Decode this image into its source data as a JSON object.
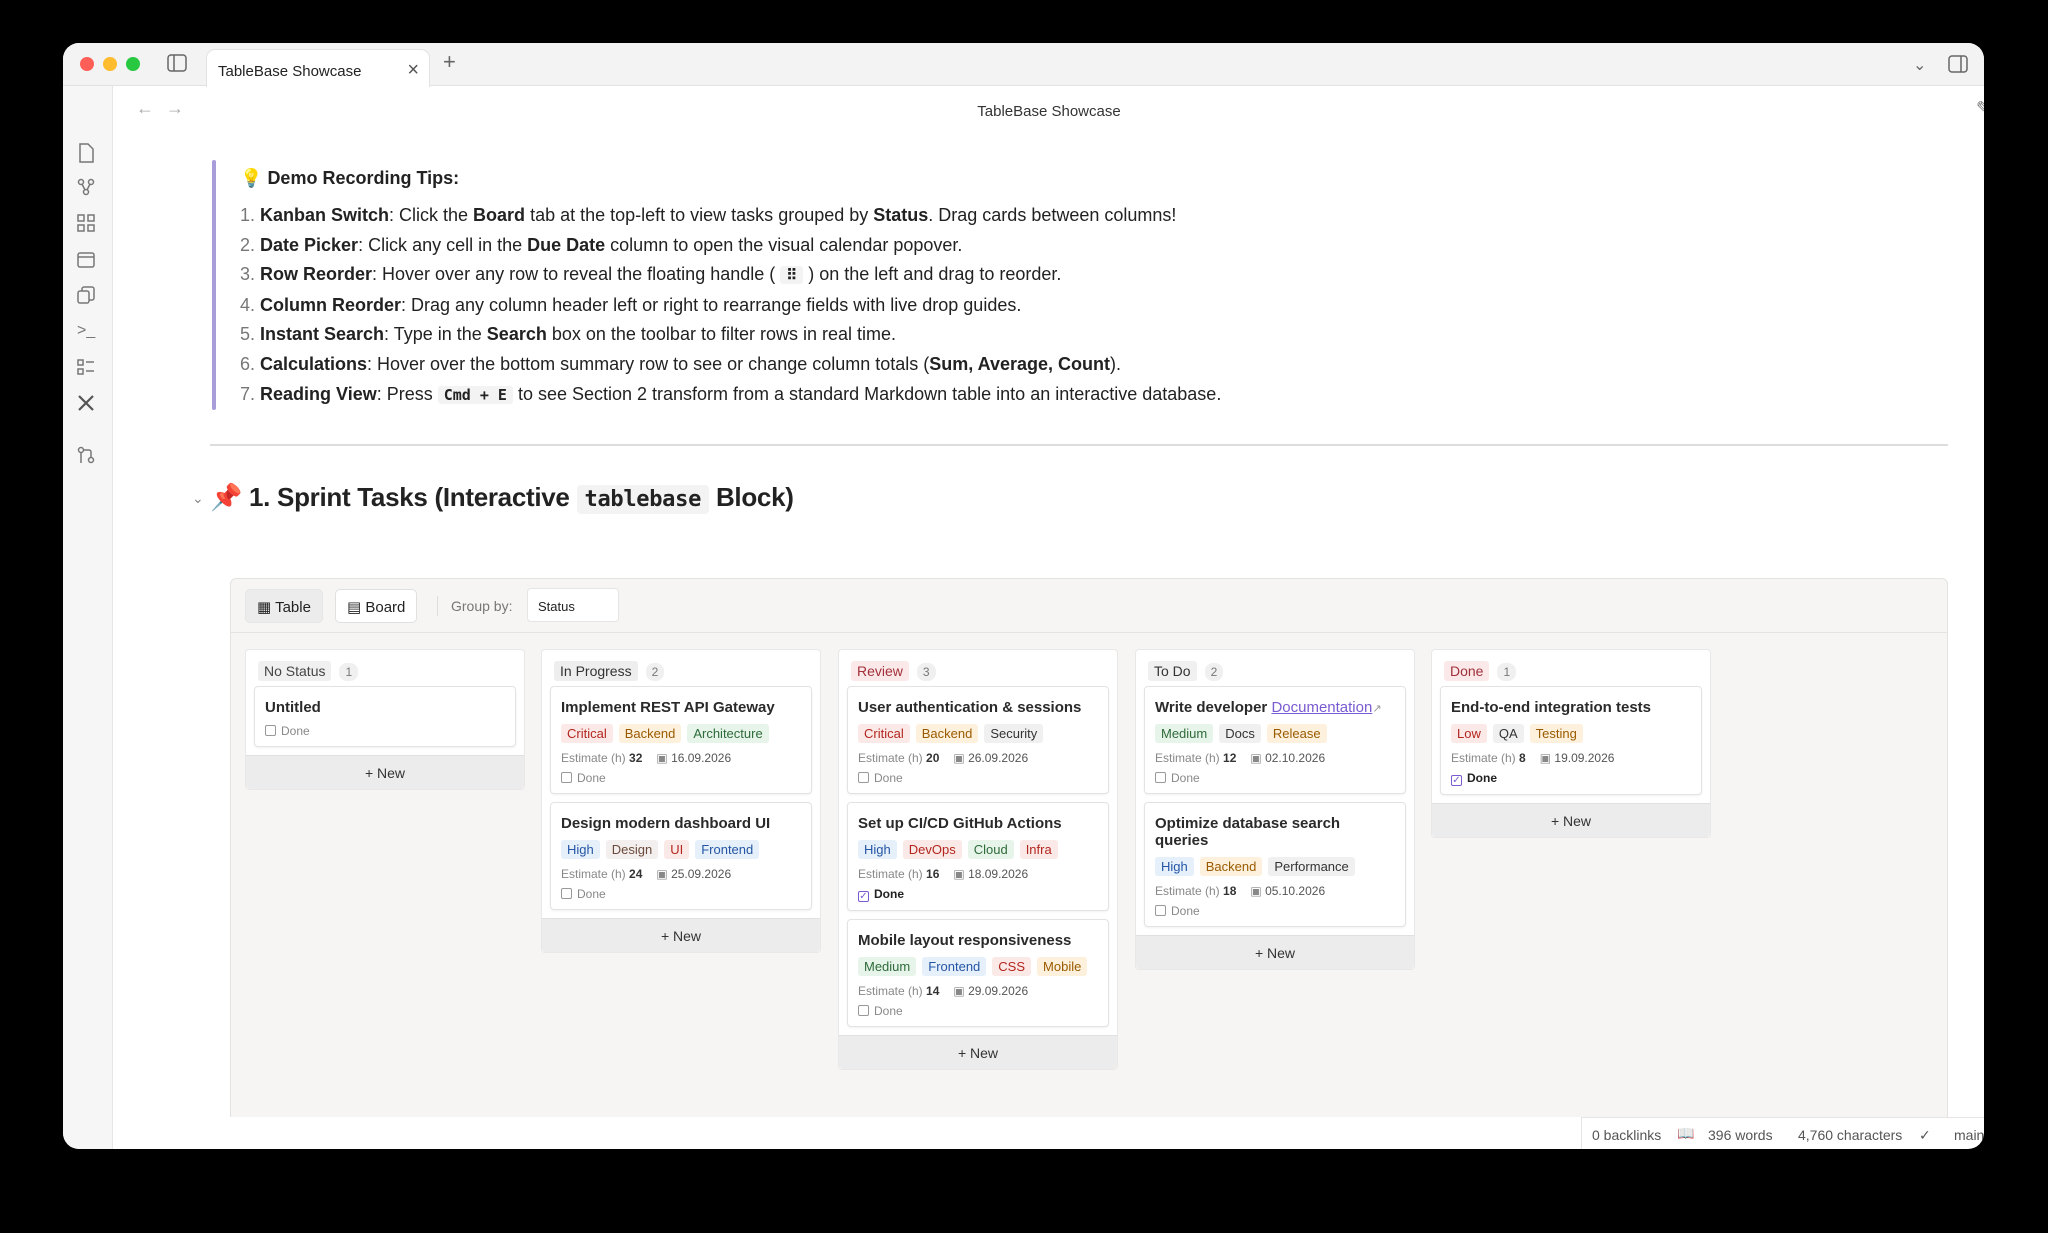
{
  "window": {
    "tab_title": "TableBase Showcase",
    "page_title": "TableBase Showcase"
  },
  "tips": {
    "title": "Demo Recording Tips:",
    "items": [
      {
        "n": "1.",
        "head": "Kanban Switch",
        "parts": [
          ": Click the ",
          "Board",
          " tab at the top-left to view tasks grouped by ",
          "Status",
          ". Drag cards between columns!"
        ]
      },
      {
        "n": "2.",
        "head": "Date Picker",
        "parts": [
          ": Click any cell in the ",
          "Due Date",
          " column to open the visual calendar popover."
        ]
      },
      {
        "n": "3.",
        "head": "Row Reorder",
        "parts": [
          ": Hover over any row to reveal the floating handle ( ",
          "⠿",
          " ) on the left and drag to reorder."
        ]
      },
      {
        "n": "4.",
        "head": "Column Reorder",
        "parts": [
          ": Drag any column header left or right to rearrange fields with live drop guides."
        ]
      },
      {
        "n": "5.",
        "head": "Instant Search",
        "parts": [
          ": Type in the ",
          "Search",
          " box on the toolbar to filter rows in real time."
        ]
      },
      {
        "n": "6.",
        "head": "Calculations",
        "parts": [
          ": Hover over the bottom summary row to see or change column totals (",
          "Sum, Average, Count",
          ")."
        ]
      },
      {
        "n": "7.",
        "head": "Reading View",
        "parts": [
          ": Press ",
          "Cmd + E",
          " to see Section 2 transform from a standard Markdown table into an interactive database."
        ]
      }
    ]
  },
  "section": {
    "prefix": "1. Sprint Tasks (Interactive ",
    "code": "tablebase",
    "suffix": " Block)"
  },
  "toolbar": {
    "table_label": "Table",
    "board_label": "Board",
    "groupby_label": "Group by:",
    "groupby_value": "Status"
  },
  "new_label": "New",
  "estimate_label": "Estimate (h)",
  "done_label": "Done",
  "columns": [
    {
      "name": "No Status",
      "count": "1",
      "color": "#f0f0f0",
      "text": "#444",
      "cards": [
        {
          "title": "Untitled",
          "tags": [],
          "estimate": "",
          "date": "",
          "done": false
        }
      ]
    },
    {
      "name": "In Progress",
      "count": "2",
      "color": "#eeeeee",
      "text": "#333",
      "cards": [
        {
          "title": "Implement REST API Gateway",
          "tags": [
            [
              "Critical",
              "#fbe9e7",
              "#b3261e"
            ],
            [
              "Backend",
              "#fdf0dc",
              "#9a5b00"
            ],
            [
              "Architecture",
              "#e7f4ea",
              "#2e6b3a"
            ]
          ],
          "estimate": "32",
          "date": "16.09.2026",
          "done": false
        },
        {
          "title": "Design modern dashboard UI",
          "tags": [
            [
              "High",
              "#e6f0fb",
              "#2456a4"
            ],
            [
              "Design",
              "#f3efee",
              "#6a4a3a"
            ],
            [
              "UI",
              "#fbe9e7",
              "#b3261e"
            ],
            [
              "Frontend",
              "#e6f0fb",
              "#2456a4"
            ]
          ],
          "estimate": "24",
          "date": "25.09.2026",
          "done": false
        }
      ]
    },
    {
      "name": "Review",
      "count": "3",
      "color": "#fbe9ea",
      "text": "#a0303a",
      "cards": [
        {
          "title": "User authentication & sessions",
          "tags": [
            [
              "Critical",
              "#fbe9e7",
              "#b3261e"
            ],
            [
              "Backend",
              "#fdf0dc",
              "#9a5b00"
            ],
            [
              "Security",
              "#f0f0f0",
              "#333"
            ]
          ],
          "estimate": "20",
          "date": "26.09.2026",
          "done": false
        },
        {
          "title": "Set up CI/CD GitHub Actions",
          "tags": [
            [
              "High",
              "#e6f0fb",
              "#2456a4"
            ],
            [
              "DevOps",
              "#fbe9e7",
              "#b3261e"
            ],
            [
              "Cloud",
              "#e7f4ea",
              "#2e6b3a"
            ],
            [
              "Infra",
              "#fbe9e7",
              "#b3261e"
            ]
          ],
          "estimate": "16",
          "date": "18.09.2026",
          "done": true
        },
        {
          "title": "Mobile layout responsiveness",
          "tags": [
            [
              "Medium",
              "#e7f4ea",
              "#2e6b3a"
            ],
            [
              "Frontend",
              "#e6f0fb",
              "#2456a4"
            ],
            [
              "CSS",
              "#fbe9e7",
              "#b3261e"
            ],
            [
              "Mobile",
              "#fdf0dc",
              "#9a5b00"
            ]
          ],
          "estimate": "14",
          "date": "29.09.2026",
          "done": false
        }
      ]
    },
    {
      "name": "To Do",
      "count": "2",
      "color": "#f0f0f0",
      "text": "#333",
      "cards": [
        {
          "title": "Write developer ",
          "link": "Documentation",
          "tags": [
            [
              "Medium",
              "#e7f4ea",
              "#2e6b3a"
            ],
            [
              "Docs",
              "#f0f0f0",
              "#333"
            ],
            [
              "Release",
              "#fdf0dc",
              "#9a5b00"
            ]
          ],
          "estimate": "12",
          "date": "02.10.2026",
          "done": false
        },
        {
          "title": "Optimize database search queries",
          "tags": [
            [
              "High",
              "#e6f0fb",
              "#2456a4"
            ],
            [
              "Backend",
              "#fdf0dc",
              "#9a5b00"
            ],
            [
              "Performance",
              "#f0f0f0",
              "#333"
            ]
          ],
          "estimate": "18",
          "date": "05.10.2026",
          "done": false
        }
      ]
    },
    {
      "name": "Done",
      "count": "1",
      "color": "#fbe9ea",
      "text": "#a0303a",
      "cards": [
        {
          "title": "End-to-end integration tests",
          "tags": [
            [
              "Low",
              "#fbe9e7",
              "#b3261e"
            ],
            [
              "QA",
              "#f0f0f0",
              "#333"
            ],
            [
              "Testing",
              "#fdf0dc",
              "#9a5b00"
            ]
          ],
          "estimate": "8",
          "date": "19.09.2026",
          "done": true
        }
      ]
    }
  ],
  "statusbar": {
    "backlinks": "0 backlinks",
    "words": "396 words",
    "chars": "4,760 characters",
    "branch": "main"
  }
}
